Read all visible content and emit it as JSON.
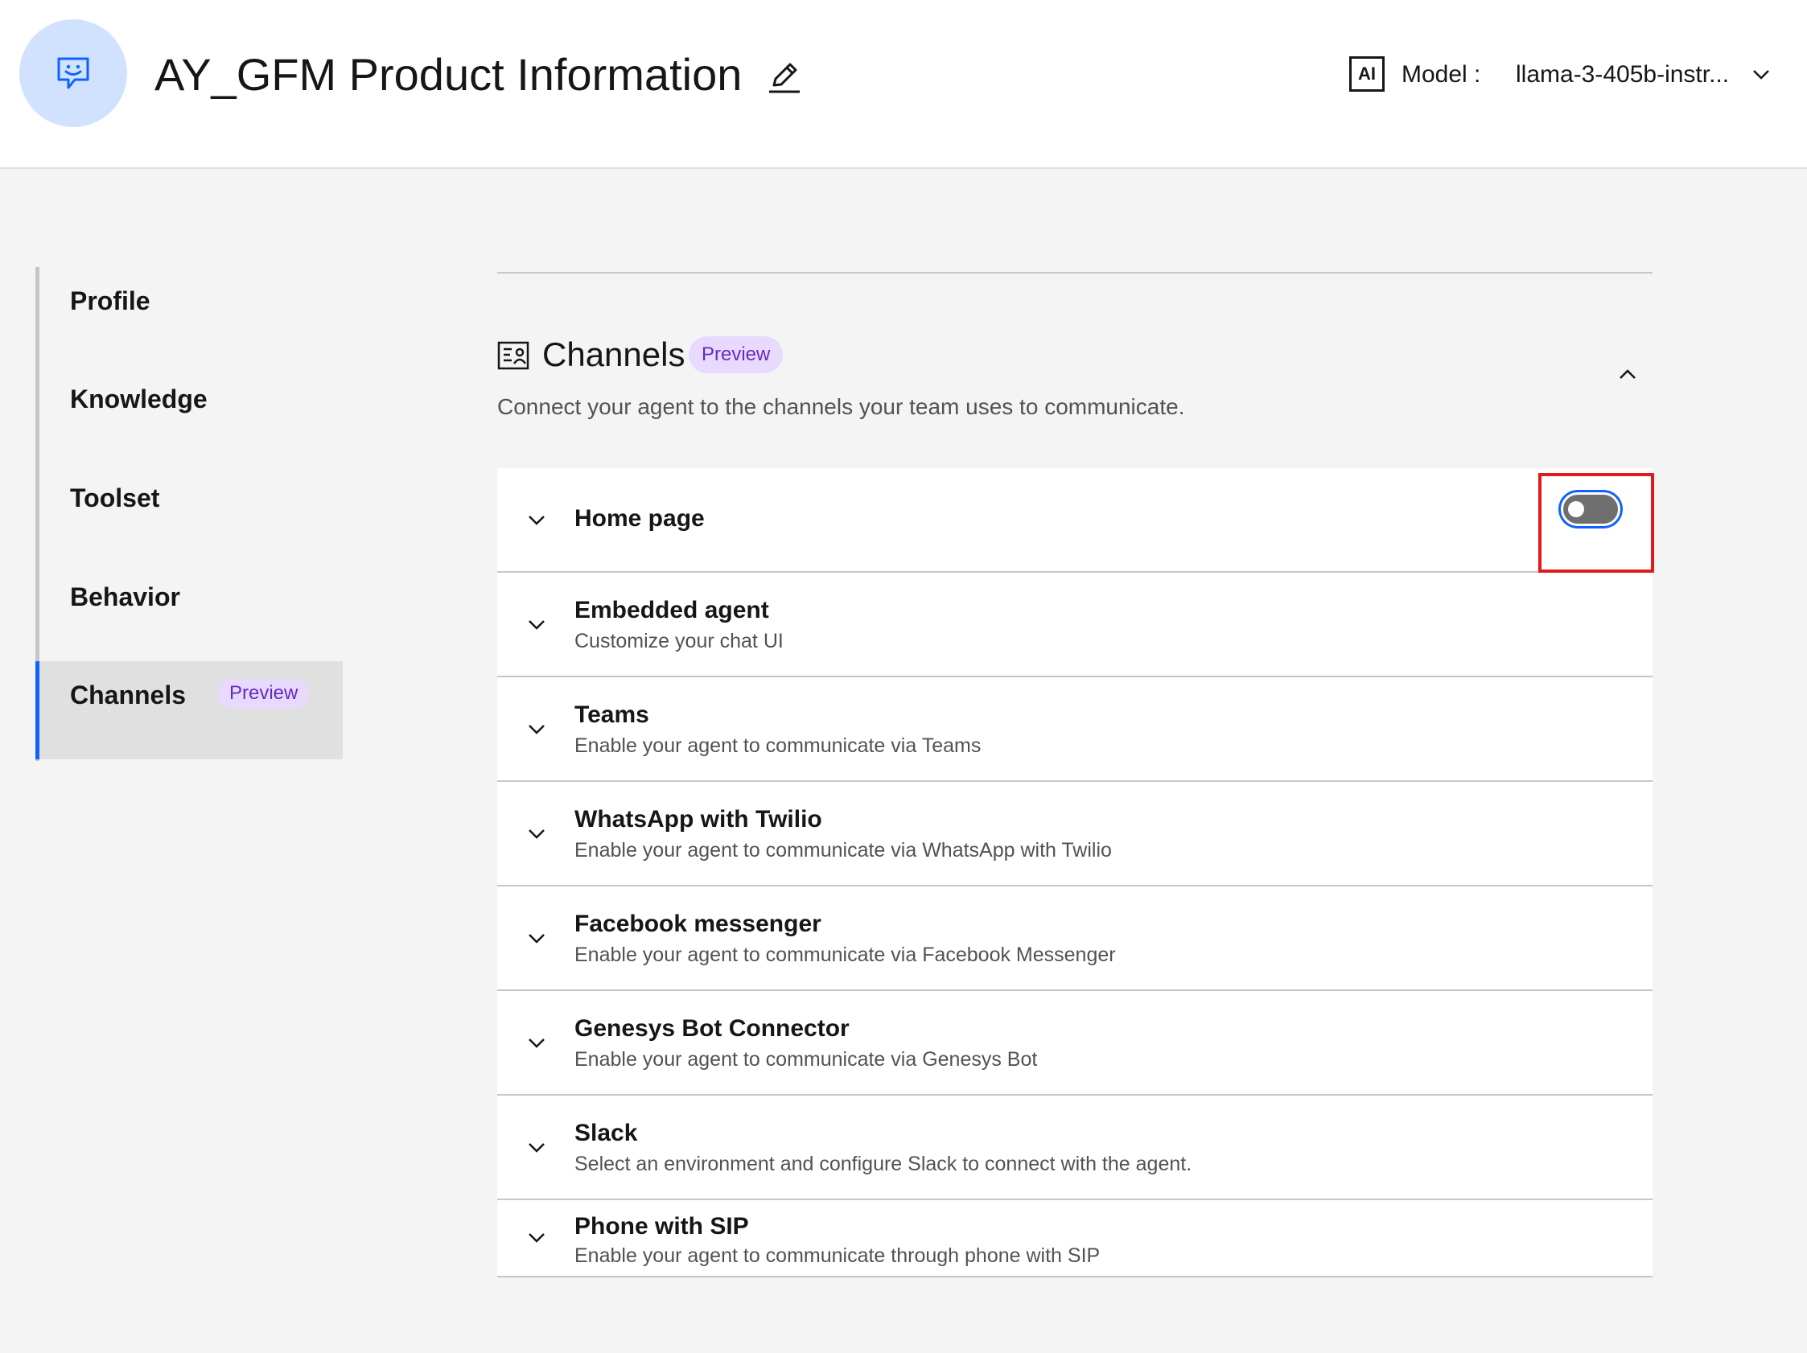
{
  "header": {
    "title": "AY_GFM Product Information",
    "ai_badge": "AI",
    "model_label": "Model :",
    "model_value": "llama-3-405b-instr..."
  },
  "sidenav": {
    "items": [
      {
        "label": "Profile"
      },
      {
        "label": "Knowledge"
      },
      {
        "label": "Toolset"
      },
      {
        "label": "Behavior"
      },
      {
        "label": "Channels",
        "tag": "Preview",
        "active": true
      }
    ]
  },
  "section": {
    "title": "Channels",
    "tag": "Preview",
    "description": "Connect your agent to the channels your team uses to communicate."
  },
  "channels": [
    {
      "title": "Home page",
      "description": "",
      "toggle": "off"
    },
    {
      "title": "Embedded agent",
      "description": "Customize your chat UI"
    },
    {
      "title": "Teams",
      "description": "Enable your agent to communicate via Teams"
    },
    {
      "title": "WhatsApp with Twilio",
      "description": "Enable your agent to communicate via WhatsApp with Twilio"
    },
    {
      "title": "Facebook messenger",
      "description": "Enable your agent to communicate via Facebook Messenger"
    },
    {
      "title": "Genesys Bot Connector",
      "description": "Enable your agent to communicate via Genesys Bot"
    },
    {
      "title": "Slack",
      "description": "Select an environment and configure Slack to connect with the agent."
    },
    {
      "title": "Phone with SIP",
      "description": "Enable your agent to communicate through phone with SIP"
    }
  ],
  "colors": {
    "accent": "#0f62fe",
    "tag_bg": "#e8daff",
    "tag_text": "#6929c4",
    "highlight": "#e41a1a"
  }
}
